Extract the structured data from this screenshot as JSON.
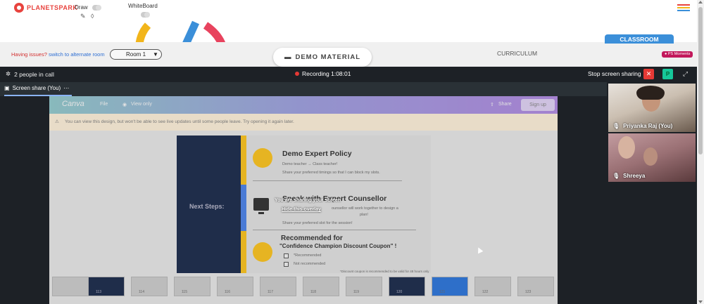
{
  "app": {
    "logo_text": "PLANETSPARK",
    "draw_label": "Draw",
    "whiteboard_label": "WhiteBoard"
  },
  "band": {
    "issue_text": "Having issues?",
    "issue_link": "switch to alternate room",
    "room_value": "Room 1",
    "demo_material": "DEMO MATERIAL",
    "curriculum": "CURRICULUM",
    "classroom": "CLASSROOM",
    "ps_moments": "PS Moments"
  },
  "call": {
    "people_count": "2 people in call",
    "recording": "Recording 1:08:01",
    "stop_sharing": "Stop screen sharing",
    "participant_initial": "P",
    "tab_label": "Screen share (You)",
    "tab_more": "⋯",
    "participants": [
      {
        "name": "Priyanka Raj (You)"
      },
      {
        "name": "Shreeya"
      }
    ]
  },
  "shared": {
    "canva_logo": "Canva",
    "canva_file": "File",
    "canva_view_only": "View only",
    "canva_share": "Share",
    "canva_signup": "Sign up",
    "notice": "You can view this design, but won't be able to see live updates until some people leave. Try opening it again later.",
    "slide": {
      "left_title": "Next Steps:",
      "s1_title": "Demo Expert Policy",
      "s1_sub": "Demo teacher → Class teacher!",
      "s1_text": "Share your preferred timings so that I can block my slots.",
      "s2_title": "Speak with Expert Counsellor",
      "s2_text1": "ounsellor will work together to design a",
      "s2_text2": "plan!",
      "s2_text3": "Share your preferred slot for the session!",
      "s3_title": "Recommended for",
      "s3_title2": "\"Confidence Champion Discount Coupon\" !",
      "opt1": "*Recommended",
      "opt2": "Not recommended",
      "footnote": "*Discount coupon is recommended to be valid for 48 hours only"
    },
    "overlay_title": "You are sharing your screen",
    "overlay_link": "Hide this overlay",
    "thumbnails": [
      "113",
      "114",
      "115",
      "116",
      "117",
      "118",
      "119",
      "120",
      "121",
      "122",
      "123"
    ]
  },
  "colors": {
    "brand_red": "#e8433e",
    "classroom_blue": "#3b8fd9",
    "record_red": "#e53935",
    "participant_green": "#16c79a"
  }
}
